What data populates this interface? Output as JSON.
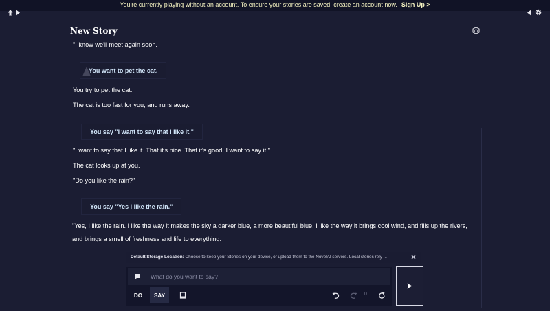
{
  "banner": {
    "message": "You're currently playing without an account. To ensure your stories are saved, create an account now.",
    "signup_label": "Sign Up >"
  },
  "top_left": {
    "icons": [
      "ai-lightbulb-icon",
      "play-arrow-icon"
    ]
  },
  "top_right": {
    "icons": [
      "collapse-arrow-icon",
      "gear-icon"
    ]
  },
  "story": {
    "title": "New Story",
    "dice_icon": "dice-icon",
    "entries": [
      {
        "kind": "text",
        "text": "\"I know we'll meet again soon."
      },
      {
        "kind": "action",
        "text": "You want to pet the cat."
      },
      {
        "kind": "text",
        "text": "You try to pet the cat."
      },
      {
        "kind": "text",
        "text": "The cat is too fast for you, and runs away."
      },
      {
        "kind": "action",
        "text": "You say \"I want to say that i like it.\""
      },
      {
        "kind": "text",
        "text": "\"I want to say that I like it. That it's nice. That it's good. I want to say it.\""
      },
      {
        "kind": "text",
        "text": "The cat looks up at you."
      },
      {
        "kind": "text",
        "text": "\"Do you like the rain?\""
      },
      {
        "kind": "action",
        "text": "You say \"Yes i like the rain.\""
      },
      {
        "kind": "text",
        "text": "\"Yes, I like the rain. I like the way it makes the sky a darker blue, a more beautiful blue. I like the way it brings cool wind, and fills up the rivers, and brings a smell of freshness and life to everything."
      }
    ]
  },
  "notice": {
    "label": "Default Storage Location:",
    "text": "Choose to keep your Stories on your device, or upload them to the NovelAI servers. Local stories rely ...",
    "close_icon": "close-icon"
  },
  "input": {
    "placeholder": "What do you want to say?",
    "value": "",
    "bubble_icon": "speech-bubble-icon",
    "do_label": "DO",
    "say_label": "SAY",
    "selected_mode": "SAY",
    "book_icon": "book-icon",
    "undo_icon": "undo-icon",
    "redo_icon": "redo-icon",
    "redo_count": "0",
    "retry_icon": "retry-icon",
    "send_icon": "send-arrow-icon"
  },
  "colors": {
    "background": "#1b1d33",
    "banner_bg": "#111326",
    "banner_text": "#f5f3c2",
    "action_text": "#cfe3f7",
    "selected_mode_bg": "#262a44"
  }
}
